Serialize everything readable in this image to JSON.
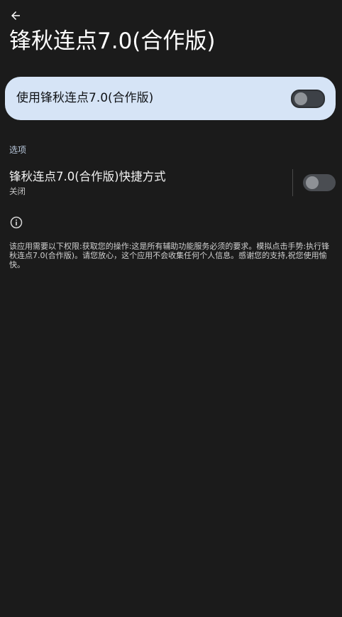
{
  "header": {
    "back_icon": "arrow-left-icon",
    "title": "锋秋连点7.0(合作版)"
  },
  "main_switch": {
    "label": "使用锋秋连点7.0(合作版)",
    "enabled": false
  },
  "options_section": {
    "header": "选项",
    "shortcut": {
      "title": "锋秋连点7.0(合作版)快捷方式",
      "summary": "关闭",
      "enabled": false
    }
  },
  "info": {
    "icon": "info-icon",
    "description": "该应用需要以下权限:获取您的操作:这是所有辅助功能服务必须的要求。模拟点击手势:执行锋秋连点7.0(合作版)。请您放心，这个应用不会收集任何个人信息。感谢您的支持,祝您使用愉快。"
  },
  "colors": {
    "background": "#1b1b1b",
    "card": "#d6e4f6",
    "toggle_track": "#4a4d52",
    "toggle_knob": "#8e9196",
    "section_header": "#b9c8dc"
  }
}
